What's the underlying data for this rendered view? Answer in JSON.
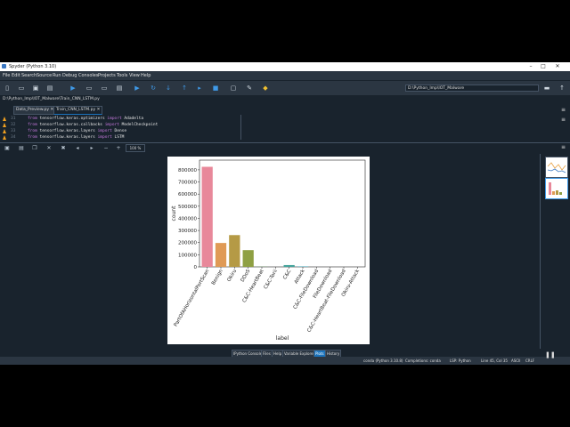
{
  "window": {
    "title": "Spyder (Python 3.10)"
  },
  "menu": [
    "File",
    "Edit",
    "Search",
    "Source",
    "Run",
    "Debug",
    "Consoles",
    "Projects",
    "Tools",
    "View",
    "Help"
  ],
  "toolbar": {
    "working_dir": "D:\\Python_Imp\\IOT_Malware"
  },
  "path_label": "D:\\Python_Imp\\IOT_Malware\\Train_CNN_LSTM.py",
  "editor": {
    "tabs": [
      {
        "label": "Data_Preview.py",
        "active": false
      },
      {
        "label": "Train_CNN_LSTM.py",
        "active": true
      }
    ],
    "lines": [
      {
        "num": "31",
        "kw1": "from",
        "mod": " tensorflow.keras.optimizers ",
        "kw2": "import",
        "name": " Adadelta"
      },
      {
        "num": "32",
        "kw1": "from",
        "mod": " tensorflow.keras.callbacks ",
        "kw2": "import",
        "name": " ModelCheckpoint"
      },
      {
        "num": "33",
        "kw1": "from",
        "mod": " tensorflow.keras.layers ",
        "kw2": "import",
        "name": " Dense"
      },
      {
        "num": "34",
        "kw1": "from",
        "mod": " tensorflow.keras.layers ",
        "kw2": "import",
        "name": " LSTM"
      }
    ]
  },
  "plots_toolbar": {
    "zoom": "100 %"
  },
  "pane_tabs": [
    {
      "label": "IPython Console",
      "active": false
    },
    {
      "label": "Files",
      "active": false
    },
    {
      "label": "Help",
      "active": false
    },
    {
      "label": "Variable Explorer",
      "active": false
    },
    {
      "label": "Plots",
      "active": true
    },
    {
      "label": "History",
      "active": false
    }
  ],
  "status": {
    "env": "conda (Python 3.10.8)",
    "completions": "Completions: conda",
    "lsp": "LSP: Python",
    "position": "Line 45, Col 35",
    "encoding": "ASCII",
    "eol": "CRLF"
  },
  "chart_data": {
    "type": "bar",
    "xlabel": "label",
    "ylabel": "count",
    "ylim": [
      0,
      880000
    ],
    "yticks": [
      0,
      100000,
      200000,
      300000,
      400000,
      500000,
      600000,
      700000,
      800000
    ],
    "categories": [
      "PartOfAHorizontalPortScan",
      "Benign",
      "Okiru",
      "DDoS",
      "C&C-HeartBeat",
      "C&C-Torii",
      "C&C",
      "Attack",
      "C&C-FileDownload",
      "FileDownload",
      "C&C-HeartBeat-FileDownload",
      "Okiru-Attack"
    ],
    "values": [
      825000,
      197000,
      262000,
      138000,
      1200,
      30,
      15000,
      3900,
      50,
      18,
      11,
      3
    ],
    "colors": [
      "#e8889a",
      "#e09a55",
      "#b59a45",
      "#8fa043",
      "#5aa648",
      "#4aa886",
      "#45a49c",
      "#44a2b5",
      "#5a9ee0",
      "#a592e6",
      "#d47fd8",
      "#e784b8"
    ]
  }
}
